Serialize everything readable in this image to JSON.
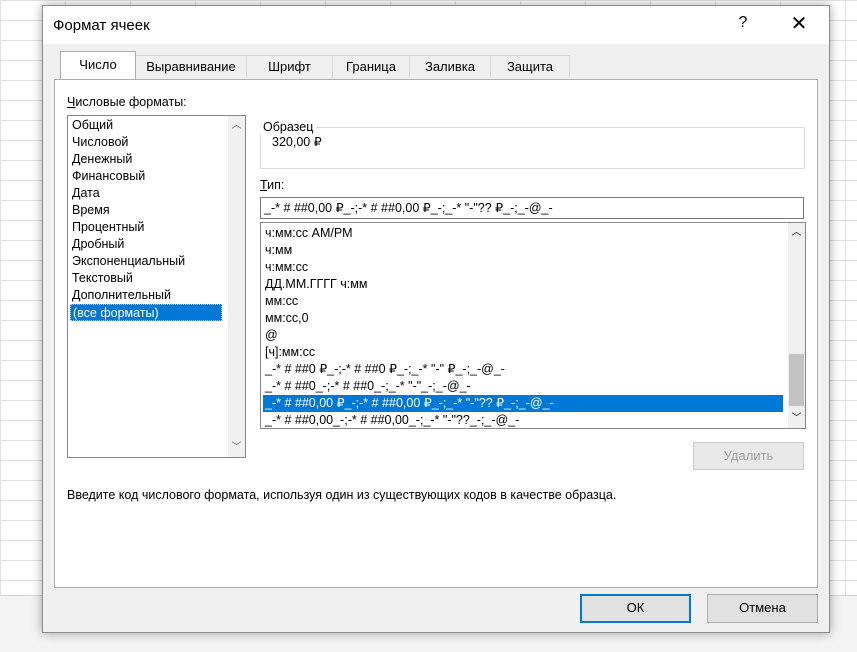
{
  "dialog": {
    "title": "Формат ячеек",
    "help_label": "?",
    "close_label": "✕"
  },
  "tabs": [
    {
      "label": "Число",
      "active": true
    },
    {
      "label": "Выравнивание",
      "active": false
    },
    {
      "label": "Шрифт",
      "active": false
    },
    {
      "label": "Граница",
      "active": false
    },
    {
      "label": "Заливка",
      "active": false
    },
    {
      "label": "Защита",
      "active": false
    }
  ],
  "categories": {
    "label_first": "Ч",
    "label_rest": "исловые форматы:",
    "items": [
      "Общий",
      "Числовой",
      "Денежный",
      "Финансовый",
      "Дата",
      "Время",
      "Процентный",
      "Дробный",
      "Экспоненциальный",
      "Текстовый",
      "Дополнительный",
      "(все форматы)"
    ],
    "selected_index": 11
  },
  "sample": {
    "title": "Образец",
    "value": "320,00 ₽"
  },
  "type": {
    "label_first": "Т",
    "label_rest": "ип:",
    "value": "_-* # ##0,00 ₽_-;-* # ##0,00 ₽_-;_-* \"-\"?? ₽_-;_-@_-"
  },
  "formats": {
    "items": [
      "ч:мм:сс AM/PM",
      "ч:мм",
      "ч:мм:сс",
      "ДД.ММ.ГГГГ ч:мм",
      "мм:сс",
      "мм:сс,0",
      "@",
      "[ч]:мм:сс",
      "_-* # ##0 ₽_-;-* # ##0 ₽_-;_-* \"-\" ₽_-;_-@_-",
      "_-* # ##0_-;-* # ##0_-;_-* \"-\"_-;_-@_-",
      "_-* # ##0,00 ₽_-;-* # ##0,00 ₽_-;_-* \"-\"?? ₽_-;_-@_-",
      "_-* # ##0,00_-;-* # ##0,00_-;_-* \"-\"??_-;_-@_-"
    ],
    "selected_index": 10
  },
  "delete_label": "Удалить",
  "hint": "Введите код числового формата, используя один из существующих кодов в качестве образца.",
  "ok_label": "ОК",
  "cancel_label": "Отмена",
  "colors": {
    "accent": "#0078d7"
  }
}
